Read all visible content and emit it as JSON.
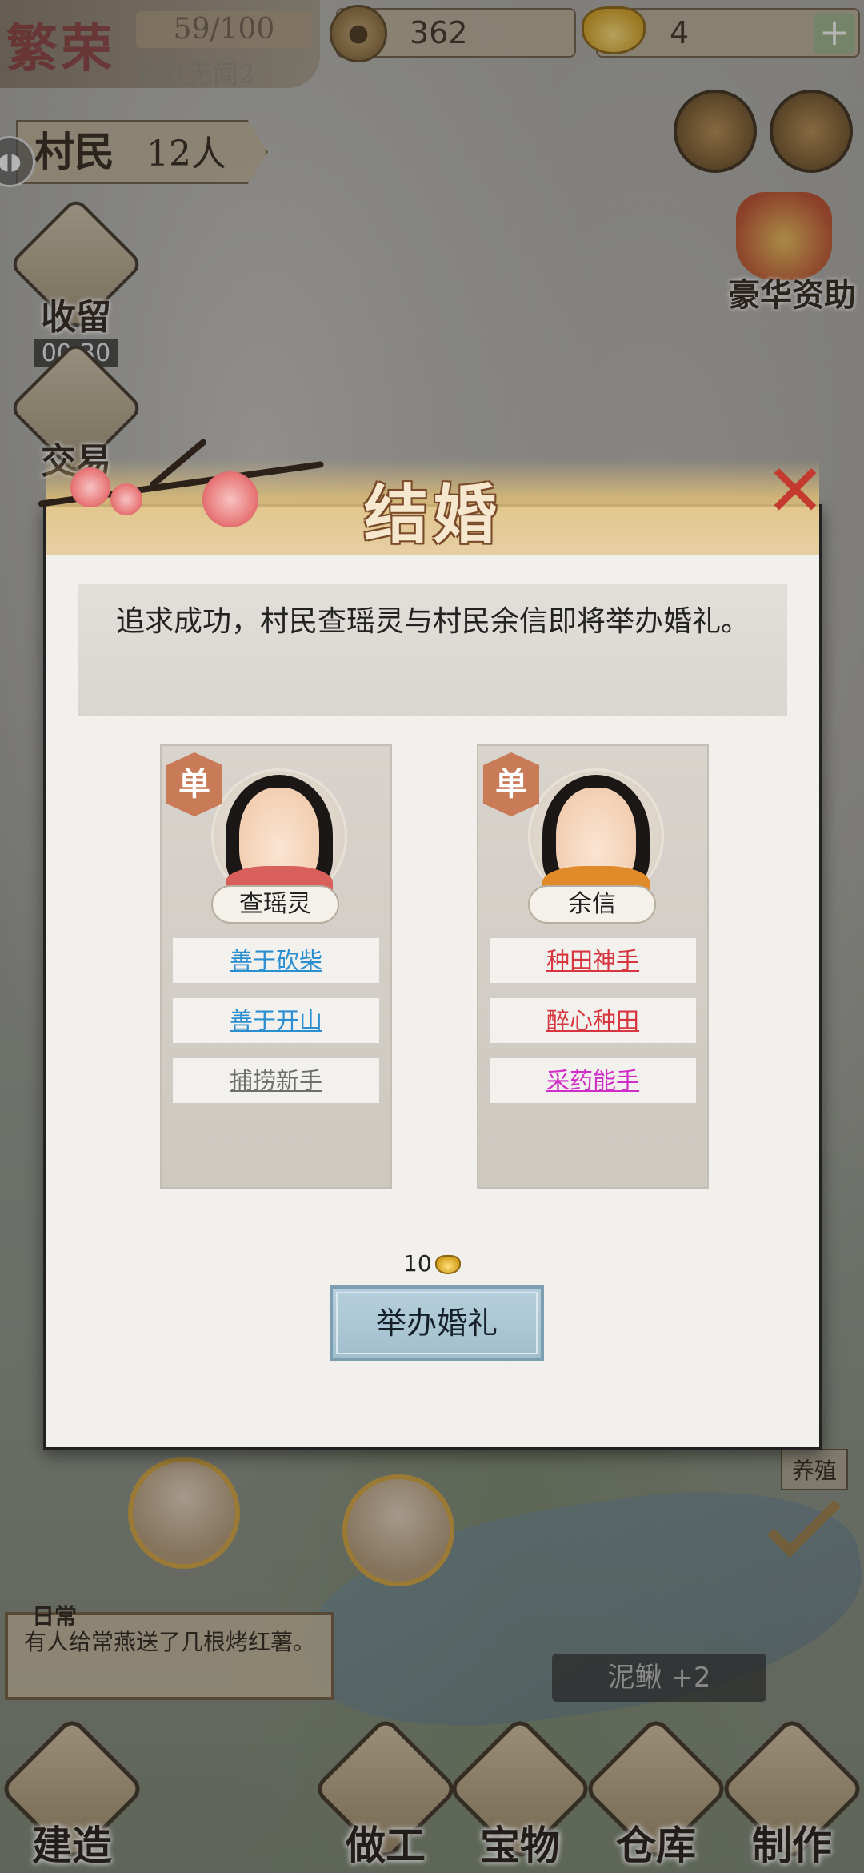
{
  "hud": {
    "rank": "繁荣",
    "progress": "59/100",
    "village_name": "默默无闻2",
    "coins": "362",
    "gold": "4",
    "villagers_label": "村民",
    "villagers_count": "12人",
    "plus": "+"
  },
  "side_buttons": {
    "shelter_label": "收留",
    "shelter_timer": "00:30",
    "trade_label": "交易"
  },
  "gift_label": "豪华资助",
  "breed_tag": "养殖",
  "log": {
    "tag": "日常",
    "text": "有人给常燕送了几根烤红薯。"
  },
  "loach_badge": "泥鳅 +2",
  "nav": [
    "建造",
    "做工",
    "宝物",
    "仓库",
    "制作"
  ],
  "modal": {
    "title": "结婚",
    "close": "✕",
    "message": "追求成功，村民查瑶灵与村民余信即将举办婚礼。",
    "cost": "10",
    "action_label": "举办婚礼",
    "left": {
      "tag": "单",
      "name": "查瑶灵",
      "traits": [
        "善于砍柴",
        "善于开山",
        "捕捞新手"
      ]
    },
    "right": {
      "tag": "单",
      "name": "余信",
      "traits": [
        "种田神手",
        "醉心种田",
        "采药能手"
      ]
    }
  },
  "colors": {
    "trait_blue": "#2a8fd0",
    "trait_gray": "#6e6e6e",
    "trait_red": "#d7353f",
    "trait_magenta": "#d02cc8",
    "accent_gold": "#d7a63c"
  }
}
